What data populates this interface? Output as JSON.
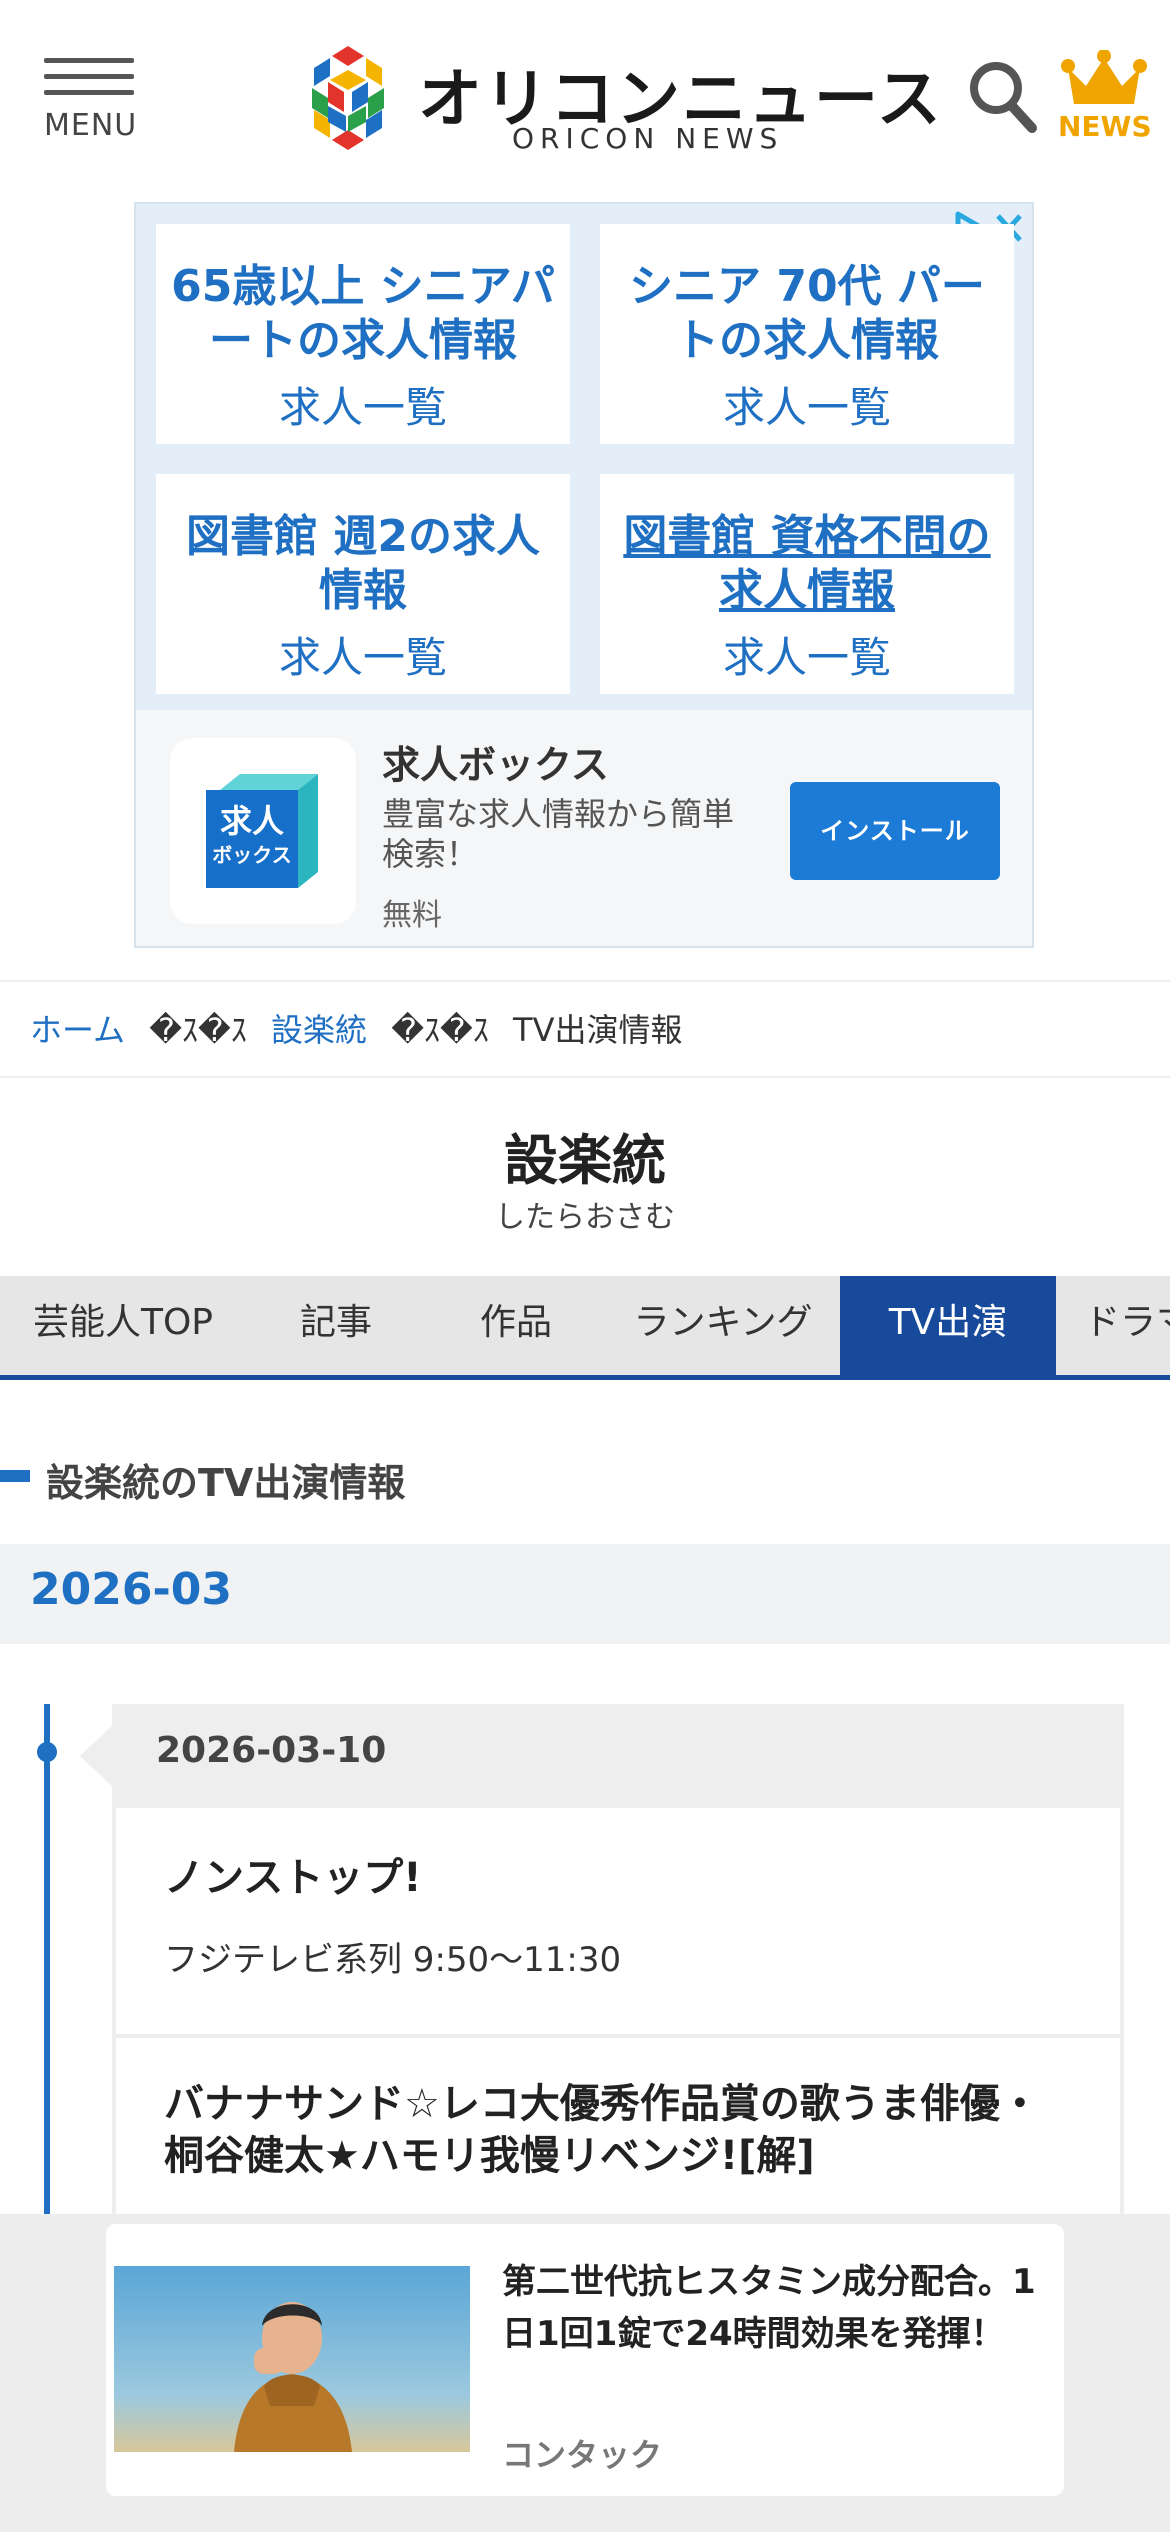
{
  "header": {
    "menu_label": "MENU",
    "logo_title": "オリコンニュース",
    "logo_sub": "ORICON NEWS",
    "news_label": "NEWS"
  },
  "ad": {
    "cells": [
      {
        "title": "65歳以上 シニアパートの求人情報",
        "link": "求人一覧"
      },
      {
        "title": "シニア 70代 パートの求人情報",
        "link": "求人一覧"
      },
      {
        "title": "図書館 週2の求人情報",
        "link": "求人一覧"
      },
      {
        "title": "図書館 資格不問の求人情報",
        "link": "求人一覧"
      }
    ],
    "app": {
      "icon_line1": "求人",
      "icon_line2": "ボックス",
      "name": "求人ボックス",
      "desc": "豊富な求人情報から簡単検索！",
      "price": "無料",
      "install_label": "インストール"
    }
  },
  "breadcrumb": {
    "home": "ホーム",
    "sep": "�ｽ�ｽ",
    "artist": "設楽統",
    "current": "TV出演情報"
  },
  "artist": {
    "name": "設楽統",
    "kana": "したらおさむ"
  },
  "tabs": [
    {
      "label": "芸能人TOP"
    },
    {
      "label": "記事"
    },
    {
      "label": "作品"
    },
    {
      "label": "ランキング"
    },
    {
      "label": "TV出演"
    },
    {
      "label": "ドラマ"
    }
  ],
  "section": {
    "title": "設楽統のTV出演情報",
    "month": "2026-03"
  },
  "timeline": {
    "date": "2026-03-10",
    "programs": [
      {
        "title": "ノンストップ!",
        "channel": "フジテレビ系列 9:50〜11:30"
      },
      {
        "title": "バナナサンド☆レコ大優秀作品賞の歌うま俳優・桐谷健太★ハモリ我慢リベンジ![解]",
        "channel": ""
      }
    ]
  },
  "sticky_ad": {
    "title": "第二世代抗ヒスタミン成分配合。1日1回1錠で24時間効果を発揮！",
    "sponsor": "コンタック"
  },
  "colors": {
    "link_blue": "#1f6fc2",
    "tab_active": "#174a9b",
    "news_gold": "#f0a400",
    "install_blue": "#1c7bd6"
  }
}
